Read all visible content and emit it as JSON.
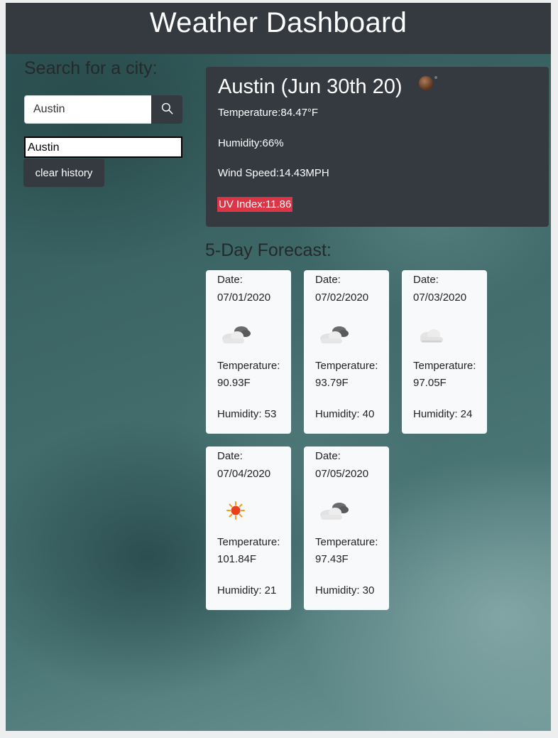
{
  "header": {
    "title": "Weather Dashboard"
  },
  "search": {
    "heading": "Search for a city:",
    "input_value": "Austin",
    "history": [
      "Austin"
    ],
    "clear_label": "clear history"
  },
  "current": {
    "title": "Austin (Jun 30th 20)",
    "icon": "night-moon-icon",
    "temperature": "Temperature:84.47°F",
    "humidity": "Humidity:66%",
    "wind": "Wind Speed:14.43MPH",
    "uv": "UV Index:11.86",
    "uv_color": "#dc3545"
  },
  "forecast": {
    "heading": "5-Day Forecast:",
    "date_label": "Date:",
    "temp_label": "Temperature:",
    "days": [
      {
        "date": "07/01/2020",
        "icon": "partly-cloudy-icon",
        "temp": "90.93F",
        "humidity": "Humidity: 53"
      },
      {
        "date": "07/02/2020",
        "icon": "partly-cloudy-icon",
        "temp": "93.79F",
        "humidity": "Humidity: 40"
      },
      {
        "date": "07/03/2020",
        "icon": "cloud-icon",
        "temp": "97.05F",
        "humidity": "Humidity: 24"
      },
      {
        "date": "07/04/2020",
        "icon": "sun-icon",
        "temp": "101.84F",
        "humidity": "Humidity: 21"
      },
      {
        "date": "07/05/2020",
        "icon": "partly-cloudy-icon",
        "temp": "97.43F",
        "humidity": "Humidity: 30"
      }
    ]
  },
  "colors": {
    "dark": "#343a40",
    "card": "#f8f9fa",
    "danger": "#dc3545"
  }
}
